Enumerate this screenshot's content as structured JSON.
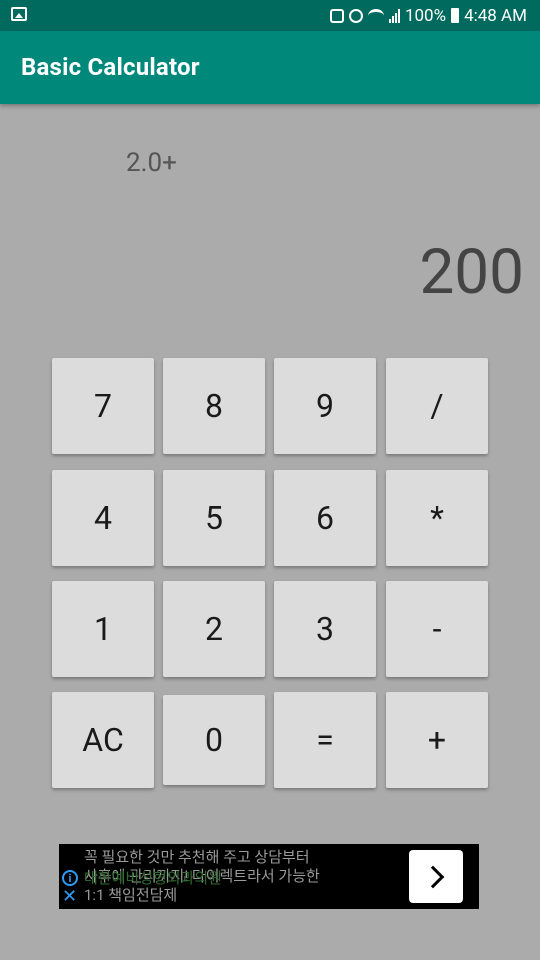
{
  "status_bar": {
    "battery": "100%",
    "time": "4:48 AM"
  },
  "app": {
    "title": "Basic Calculator"
  },
  "display": {
    "expression": "2.0+",
    "result": "200"
  },
  "keypad": {
    "k7": "7",
    "k8": "8",
    "k9": "9",
    "div": "/",
    "k4": "4",
    "k5": "5",
    "k6": "6",
    "mul": "*",
    "k1": "1",
    "k2": "2",
    "k3": "3",
    "sub": "-",
    "ac": "AC",
    "k0": "0",
    "eq": "=",
    "add": "+"
  },
  "ad": {
    "line1": "꼭 필요한 것만 추천해 주고 상담부터",
    "line2": "사후에 관리까지! 다이렉트라서 가능한",
    "line3": "1:1 책임전담제",
    "overlay": "대한예비성형외과의원"
  },
  "colors": {
    "primary": "#00897b",
    "primary_dark": "#006a5f",
    "background": "#ababab",
    "key": "#dcdcdc"
  }
}
